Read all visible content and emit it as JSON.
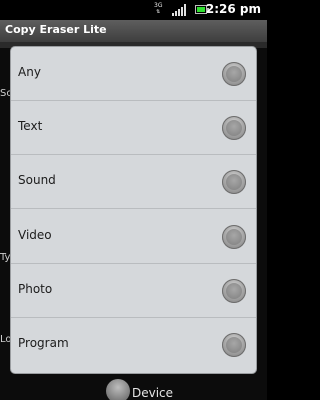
{
  "status_bar": {
    "network": "3G",
    "time": "2:26 pm",
    "icons": [
      "network-3g-icon",
      "signal-icon",
      "battery-icon"
    ]
  },
  "app": {
    "title": "Copy Eraser Lite"
  },
  "background": {
    "partial_labels": [
      "Sc",
      "Ty",
      "Lo"
    ]
  },
  "dialog": {
    "options": [
      {
        "label": "Any",
        "selected": false
      },
      {
        "label": "Text",
        "selected": false
      },
      {
        "label": "Sound",
        "selected": false
      },
      {
        "label": "Video",
        "selected": false
      },
      {
        "label": "Photo",
        "selected": false
      },
      {
        "label": "Program",
        "selected": false
      }
    ]
  },
  "footer": {
    "device_label": "Device"
  }
}
